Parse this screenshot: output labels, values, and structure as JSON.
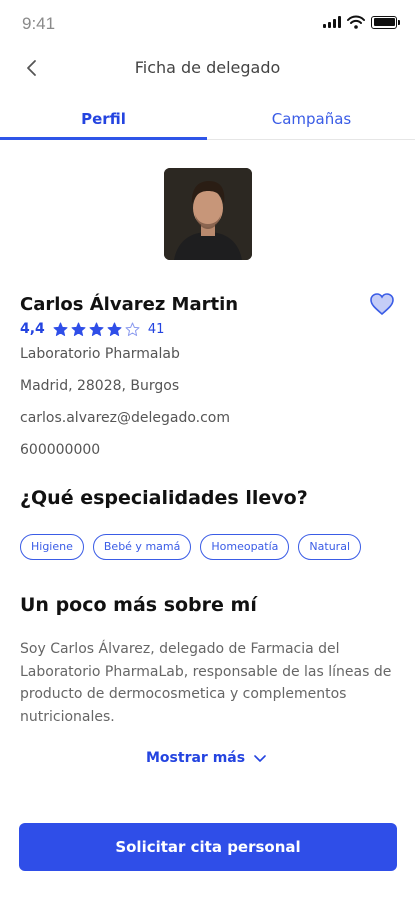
{
  "status": {
    "time": "9:41"
  },
  "header": {
    "title": "Ficha de delegado"
  },
  "tabs": [
    {
      "label": "Perfil",
      "active": true
    },
    {
      "label": "Campañas",
      "active": false
    }
  ],
  "profile": {
    "name": "Carlos Álvarez Martin",
    "rating": "4,4",
    "stars_filled": 4,
    "stars_total": 5,
    "reviews": "41",
    "laboratory": "Laboratorio Pharmalab",
    "address": "Madrid, 28028, Burgos",
    "email": "carlos.alvarez@delegado.com",
    "phone": "600000000",
    "favorite": false
  },
  "specialties": {
    "title": "¿Qué especialidades llevo?",
    "items": [
      "Higiene",
      "Bebé y mamá",
      "Homeopatía",
      "Natural"
    ]
  },
  "about": {
    "title": "Un poco más sobre mí",
    "text": "Soy Carlos Álvarez, delegado de Farmacia del Laboratorio PharmaLab, responsable de las líneas de producto de dermocosmetica y complementos nutricionales.",
    "show_more_label": "Mostrar más"
  },
  "cta": {
    "label": "Solicitar cita personal"
  },
  "colors": {
    "accent": "#2f4ee8",
    "text": "#111111",
    "muted": "#666666"
  },
  "icons": {
    "back": "chevron-left-icon",
    "favorite": "heart-icon",
    "star": "star-icon",
    "show_more": "chevron-down-icon"
  }
}
